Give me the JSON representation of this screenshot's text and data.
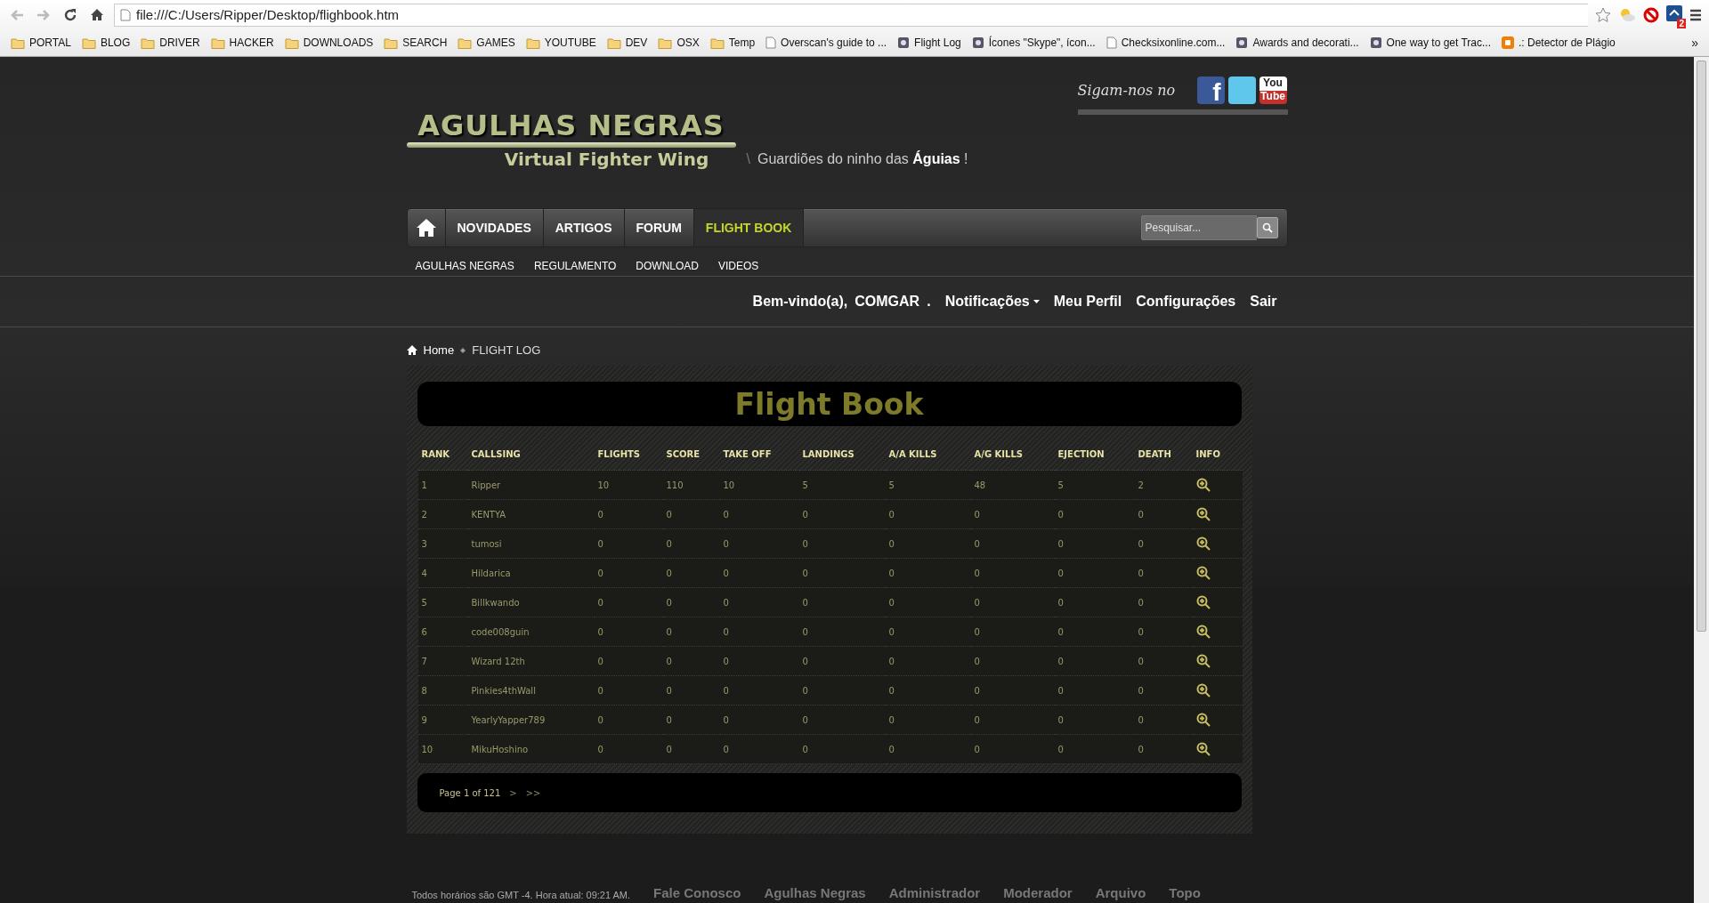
{
  "browser": {
    "address": "file:///C:/Users/Ripper/Desktop/flighbook.htm",
    "extension_badge": "2",
    "bookmarks": [
      {
        "label": "PORTAL",
        "kind": "folder"
      },
      {
        "label": "BLOG",
        "kind": "folder"
      },
      {
        "label": "DRIVER",
        "kind": "folder"
      },
      {
        "label": "HACKER",
        "kind": "folder"
      },
      {
        "label": "DOWNLOADS",
        "kind": "folder"
      },
      {
        "label": "SEARCH",
        "kind": "folder"
      },
      {
        "label": "GAMES",
        "kind": "folder"
      },
      {
        "label": "YOUTUBE",
        "kind": "folder"
      },
      {
        "label": "DEV",
        "kind": "folder"
      },
      {
        "label": "OSX",
        "kind": "folder"
      },
      {
        "label": "Temp",
        "kind": "folder"
      },
      {
        "label": "Overscan's guide to ...",
        "kind": "page"
      },
      {
        "label": "Flight Log",
        "kind": "site"
      },
      {
        "label": "Ícones \"Skype\", ícon...",
        "kind": "site"
      },
      {
        "label": "Checksixonline.com...",
        "kind": "page"
      },
      {
        "label": "Awards and decorati...",
        "kind": "site"
      },
      {
        "label": "One way to get Trac...",
        "kind": "site"
      },
      {
        "label": ".: Detector de Plágio",
        "kind": "blog"
      }
    ],
    "more": "»"
  },
  "header": {
    "follow_label": "Sigam-nos no",
    "social": [
      {
        "kind": "facebook",
        "glyph": "f"
      },
      {
        "kind": "twitter"
      },
      {
        "kind": "youtube",
        "glyph": "You",
        "glyph2": "Tube"
      }
    ],
    "logo_title": "AGULHAS NEGRAS",
    "logo_subtitle": "Virtual Fighter Wing",
    "separator": "\\",
    "tagline": "Guardiões do ninho das **Águias** !"
  },
  "nav": {
    "items": [
      {
        "label": "NOVIDADES",
        "selected": false
      },
      {
        "label": "ARTIGOS",
        "selected": false
      },
      {
        "label": "FORUM",
        "selected": false
      },
      {
        "label": "FLIGHT BOOK",
        "selected": true
      }
    ],
    "search": {
      "placeholder": "Pesquisar..."
    }
  },
  "subnav": [
    "AGULHAS NEGRAS",
    "REGULAMENTO",
    "DOWNLOAD",
    "VIDEOS"
  ],
  "user_bar": {
    "greeting": "Bem-vindo(a),",
    "username": "COMGAR",
    "dot": ".",
    "links": [
      {
        "label": "Notificações",
        "dropdown": true
      },
      {
        "label": "Meu Perfil",
        "dropdown": false
      },
      {
        "label": "Configurações",
        "dropdown": false
      },
      {
        "label": "Sair",
        "dropdown": false
      }
    ]
  },
  "breadcrumb": [
    "Home",
    "FLIGHT LOG"
  ],
  "flight_book": {
    "title": "Flight Book",
    "columns": [
      "RANK",
      "CALLSING",
      "FLIGHTS",
      "SCORE",
      "TAKE OFF",
      "LANDINGS",
      "A/A KILLS",
      "A/G KILLS",
      "EJECTION",
      "DEATH",
      "INFO"
    ],
    "rows": [
      [
        "1",
        "Ripper",
        "10",
        "110",
        "10",
        "5",
        "5",
        "48",
        "5",
        "2"
      ],
      [
        "2",
        "KENTYA",
        "0",
        "0",
        "0",
        "0",
        "0",
        "0",
        "0",
        "0"
      ],
      [
        "3",
        "tumosi",
        "0",
        "0",
        "0",
        "0",
        "0",
        "0",
        "0",
        "0"
      ],
      [
        "4",
        "Hildarica",
        "0",
        "0",
        "0",
        "0",
        "0",
        "0",
        "0",
        "0"
      ],
      [
        "5",
        "Billkwando",
        "0",
        "0",
        "0",
        "0",
        "0",
        "0",
        "0",
        "0"
      ],
      [
        "6",
        "code008guin",
        "0",
        "0",
        "0",
        "0",
        "0",
        "0",
        "0",
        "0"
      ],
      [
        "7",
        "Wizard 12th",
        "0",
        "0",
        "0",
        "0",
        "0",
        "0",
        "0",
        "0"
      ],
      [
        "8",
        "Pinkies4thWall",
        "0",
        "0",
        "0",
        "0",
        "0",
        "0",
        "0",
        "0"
      ],
      [
        "9",
        "YearlyYapper789",
        "0",
        "0",
        "0",
        "0",
        "0",
        "0",
        "0",
        "0"
      ],
      [
        "10",
        "MikuHoshino",
        "0",
        "0",
        "0",
        "0",
        "0",
        "0",
        "0",
        "0"
      ]
    ],
    "pagination": {
      "status": "Page 1 of 121",
      "next": ">",
      "last": ">>"
    }
  },
  "footer": {
    "time": "Todos horários são GMT -4. Hora atual: 09:21 AM.",
    "links": [
      "Fale Conosco",
      "Agulhas Negras",
      "Administrador",
      "Moderador",
      "Arquivo",
      "Topo"
    ]
  }
}
